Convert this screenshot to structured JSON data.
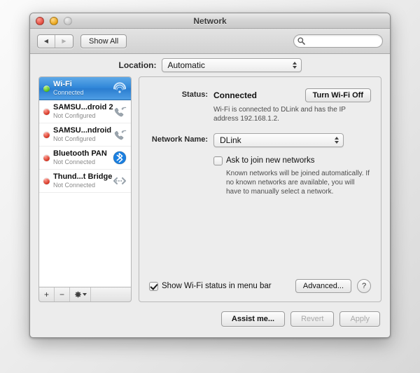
{
  "window": {
    "title": "Network",
    "traffic_lights": [
      "close",
      "minimize",
      "zoom"
    ]
  },
  "toolbar": {
    "back_icon": "back-arrow-icon",
    "forward_icon": "forward-arrow-icon",
    "show_all_label": "Show All",
    "search_placeholder": "",
    "search_value": "",
    "search_icon": "search-icon"
  },
  "location": {
    "label": "Location:",
    "value": "Automatic"
  },
  "sidebar": {
    "services": [
      {
        "name": "Wi-Fi",
        "status": "Connected",
        "dot": "green",
        "icon": "wifi-icon",
        "selected": true
      },
      {
        "name": "SAMSU...droid 2",
        "status": "Not Configured",
        "dot": "red",
        "icon": "phone-icon",
        "selected": false
      },
      {
        "name": "SAMSU...ndroid",
        "status": "Not Configured",
        "dot": "red",
        "icon": "phone-icon",
        "selected": false
      },
      {
        "name": "Bluetooth PAN",
        "status": "Not Connected",
        "dot": "red",
        "icon": "bluetooth-icon",
        "selected": false
      },
      {
        "name": "Thund...t Bridge",
        "status": "Not Connected",
        "dot": "red",
        "icon": "thunderbolt-icon",
        "selected": false
      }
    ],
    "toolbar": {
      "add_label": "+",
      "remove_label": "−",
      "gear_icon": "gear-icon"
    }
  },
  "main": {
    "status_label": "Status:",
    "status_value": "Connected",
    "turn_off_label": "Turn Wi-Fi Off",
    "status_description": "Wi-Fi is connected to DLink and has the IP address 192.168.1.2.",
    "network_name_label": "Network Name:",
    "network_name_value": "DLink",
    "ask_join_label": "Ask to join new networks",
    "ask_join_checked": false,
    "ask_join_description": "Known networks will be joined automatically. If no known networks are available, you will have to manually select a network.",
    "show_status_label": "Show Wi-Fi status in menu bar",
    "show_status_checked": true,
    "advanced_label": "Advanced...",
    "help_label": "?"
  },
  "footer": {
    "assist_label": "Assist me...",
    "revert_label": "Revert",
    "apply_label": "Apply"
  }
}
